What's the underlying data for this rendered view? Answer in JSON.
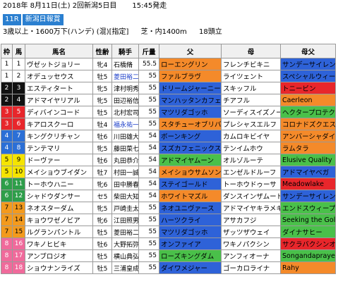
{
  "header": {
    "date": "2018年 8月11日(土) 2回新潟5日目",
    "post_time": "15:45発走",
    "race_no": "11R",
    "race_name": "新潟日報賞",
    "conditions": "3歳以上・1600万下(ハンデ) (混)[指定]",
    "course": "芝・内1400m",
    "field_size": "18頭立"
  },
  "columns": [
    "枠",
    "馬",
    "馬名",
    "性齢",
    "騎手",
    "斤量",
    "父",
    "母",
    "母父"
  ],
  "colors": {
    "waku": {
      "1": "#ffffff",
      "2": "#111111",
      "3": "#e8262b",
      "4": "#2b6fd6",
      "5": "#f5e400",
      "6": "#2e9e4a",
      "7": "#f39a1d",
      "8": "#f06a9b"
    },
    "waku_text": {
      "1": "#000000",
      "2": "#ffffff",
      "3": "#ffffff",
      "4": "#ffffff",
      "5": "#000000",
      "6": "#ffffff",
      "7": "#000000",
      "8": "#ffffff"
    }
  },
  "horses": [
    {
      "waku": "1",
      "uma": "1",
      "name": "ヴゼットジョリー",
      "sex_age": "牝4",
      "jockey": "石橋脩",
      "jockey_blue": false,
      "weight": "55.5",
      "sire": "ローエングリン",
      "sire_color": "#f48a2a",
      "dam": "フレンチビキニ",
      "dam_color": "#ffffff",
      "bms": "サンデーサイレンス",
      "bms_color": "#2e62d8"
    },
    {
      "waku": "1",
      "uma": "2",
      "name": "オデュッセウス",
      "sex_age": "牡5",
      "jockey": "菱田裕二",
      "jockey_blue": true,
      "weight": "55",
      "sire": "ファルブラヴ",
      "sire_color": "#f48a2a",
      "dam": "ライツェント",
      "dam_color": "#ffffff",
      "bms": "スペシャルウィーク",
      "bms_color": "#2e62d8"
    },
    {
      "waku": "2",
      "uma": "3",
      "name": "エスティタート",
      "sex_age": "牝5",
      "jockey": "津村明秀",
      "jockey_blue": false,
      "weight": "55",
      "sire": "ドリームジャーニー",
      "sire_color": "#2e62d8",
      "dam": "スキッフル",
      "dam_color": "#ffffff",
      "bms": "トニービン",
      "bms_color": "#e8262b"
    },
    {
      "waku": "2",
      "uma": "4",
      "name": "アドマイヤリアル",
      "sex_age": "牝5",
      "jockey": "田辺裕信",
      "jockey_blue": false,
      "weight": "55",
      "sire": "マンハッタンカフェ",
      "sire_color": "#2e62d8",
      "dam": "チアフル",
      "dam_color": "#ffffff",
      "bms": "Caerleon",
      "bms_color": "#f48a2a"
    },
    {
      "waku": "3",
      "uma": "5",
      "name": "ディバインコード",
      "sex_age": "牡5",
      "jockey": "北村宏司",
      "jockey_blue": false,
      "weight": "55",
      "sire": "マツリダゴッホ",
      "sire_color": "#2e62d8",
      "dam": "ソーディスイズノーチス",
      "dam_color": "#ffffff",
      "bms": "ヘクタープロテクター",
      "bms_color": "#4ac04a"
    },
    {
      "waku": "3",
      "uma": "6",
      "name": "キアロスクーロ",
      "sex_age": "牡4",
      "jockey": "福永祐一",
      "jockey_blue": true,
      "weight": "55",
      "sire": "スタチューオブリバティ",
      "sire_color": "#f48a2a",
      "dam": "プレシャスエルフ",
      "dam_color": "#ffffff",
      "bms": "コロナドズクエスト",
      "bms_color": "#f48a2a"
    },
    {
      "waku": "4",
      "uma": "7",
      "name": "キングクリチャン",
      "sex_age": "牡6",
      "jockey": "川田雄大",
      "jockey_blue": false,
      "weight": "54",
      "sire": "ボーンキング",
      "sire_color": "#2e62d8",
      "dam": "カムロキビイヤ",
      "dam_color": "#ffffff",
      "bms": "アンバーシャダイ",
      "bms_color": "#f48a2a"
    },
    {
      "waku": "4",
      "uma": "8",
      "name": "テンテマリ",
      "sex_age": "牝5",
      "jockey": "藤田菜七",
      "jockey_blue": false,
      "weight": "54",
      "sire": "スズカフェニックス",
      "sire_color": "#2e62d8",
      "dam": "テンイムホウ",
      "dam_color": "#ffffff",
      "bms": "ラムタラ",
      "bms_color": "#f48a2a"
    },
    {
      "waku": "5",
      "uma": "9",
      "name": "ドーヴァー",
      "sex_age": "牡6",
      "jockey": "丸田恭介",
      "jockey_blue": false,
      "weight": "54",
      "sire": "アドマイヤムーン",
      "sire_color": "#4ac04a",
      "dam": "オルゾルーテ",
      "dam_color": "#ffffff",
      "bms": "Elusive Quality",
      "bms_color": "#4ac04a"
    },
    {
      "waku": "5",
      "uma": "10",
      "name": "メイショウブイダン",
      "sex_age": "牡7",
      "jockey": "村田一誠",
      "jockey_blue": false,
      "weight": "54",
      "sire": "メイショウサムソン",
      "sire_color": "#f48a2a",
      "dam": "エンゼルドルーフ",
      "dam_color": "#ffffff",
      "bms": "アドマイヤベガ",
      "bms_color": "#2e62d8"
    },
    {
      "waku": "6",
      "uma": "11",
      "name": "トーホウハニー",
      "sex_age": "牝6",
      "jockey": "田中勝春",
      "jockey_blue": false,
      "weight": "54",
      "sire": "ステイゴールド",
      "sire_color": "#2e62d8",
      "dam": "トーホウドゥーサ",
      "dam_color": "#ffffff",
      "bms": "Meadowlake",
      "bms_color": "#e8262b"
    },
    {
      "waku": "6",
      "uma": "12",
      "name": "シャドウダンサー",
      "sex_age": "セ5",
      "jockey": "柴田大知",
      "jockey_blue": false,
      "weight": "54",
      "sire": "ホワイトマズル",
      "sire_color": "#f48a2a",
      "dam": "ダンスインザムード",
      "dam_color": "#ffffff",
      "bms": "サンデーサイレンス",
      "bms_color": "#2e62d8"
    },
    {
      "waku": "7",
      "uma": "13",
      "name": "ネオスターダム",
      "sex_age": "牝5",
      "jockey": "戸崎圭太",
      "jockey_blue": false,
      "weight": "55",
      "sire": "ネオユニヴァース",
      "sire_color": "#2e62d8",
      "dam": "アドマイヤキラメキ",
      "dam_color": "#ffffff",
      "bms": "エンドスウィープ",
      "bms_color": "#4ac04a"
    },
    {
      "waku": "7",
      "uma": "14",
      "name": "キョウワゼノビア",
      "sex_age": "牝6",
      "jockey": "江田照男",
      "jockey_blue": false,
      "weight": "55",
      "sire": "ハーツクライ",
      "sire_color": "#2e62d8",
      "dam": "アサカフジ",
      "dam_color": "#ffffff",
      "bms": "Seeking the Gold",
      "bms_color": "#4ac04a"
    },
    {
      "waku": "7",
      "uma": "15",
      "name": "ルグランパントル",
      "sex_age": "牡5",
      "jockey": "菱田裕二",
      "jockey_blue": false,
      "weight": "55",
      "sire": "マツリダゴッホ",
      "sire_color": "#2e62d8",
      "dam": "ザッツザウェイ",
      "dam_color": "#ffffff",
      "bms": "ダイナサヒー",
      "bms_color": "#4ac04a"
    },
    {
      "waku": "8",
      "uma": "16",
      "name": "ワキノヒビキ",
      "sex_age": "牡6",
      "jockey": "大野拓弥",
      "jockey_blue": false,
      "weight": "55",
      "sire": "オンファイア",
      "sire_color": "#2e62d8",
      "dam": "ワキノパクシン",
      "dam_color": "#ffffff",
      "bms": "サクラバクシンオー",
      "bms_color": "#e8262b"
    },
    {
      "waku": "8",
      "uma": "17",
      "name": "アンブロジオ",
      "sex_age": "牡5",
      "jockey": "横山典弘",
      "jockey_blue": false,
      "weight": "55",
      "sire": "ローズキングダム",
      "sire_color": "#4ac04a",
      "dam": "アンフィオーナ",
      "dam_color": "#ffffff",
      "bms": "Songandaprayer",
      "bms_color": "#4ac04a"
    },
    {
      "waku": "8",
      "uma": "18",
      "name": "ショウナンライズ",
      "sex_age": "牡5",
      "jockey": "三浦皇成",
      "jockey_blue": false,
      "weight": "55",
      "sire": "ダイワメジャー",
      "sire_color": "#2e62d8",
      "dam": "ゴーカロライナ",
      "dam_color": "#ffffff",
      "bms": "Rahy",
      "bms_color": "#f48a2a"
    }
  ]
}
